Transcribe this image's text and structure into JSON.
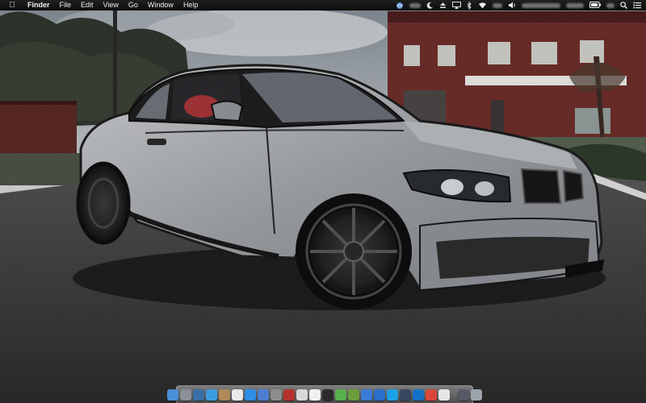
{
  "menubar": {
    "apple_icon": "apple-logo-icon",
    "app_name": "Finder",
    "items": [
      "File",
      "Edit",
      "View",
      "Go",
      "Window",
      "Help"
    ],
    "status_icons": [
      "globe-sync-icon",
      "crescent-icon",
      "eject-icon",
      "display-mirroring-icon",
      "bluetooth-icon",
      "wifi-icon",
      "volume-icon",
      "battery-icon",
      "spotlight-search-icon",
      "notification-center-icon"
    ]
  },
  "dock": {
    "apps": [
      {
        "name": "finder",
        "icon": "finder-icon",
        "color": "#4a90d9"
      },
      {
        "name": "launchpad",
        "icon": "launchpad-rocket-icon",
        "color": "#8a8f99"
      },
      {
        "name": "mission-control",
        "icon": "mission-control-icon",
        "color": "#3a6ea5"
      },
      {
        "name": "safari",
        "icon": "safari-compass-icon",
        "color": "#3b9de0"
      },
      {
        "name": "contacts",
        "icon": "contacts-book-icon",
        "color": "#b08a5a"
      },
      {
        "name": "calendar",
        "icon": "calendar-icon",
        "color": "#e9e9e9"
      },
      {
        "name": "app-store",
        "icon": "app-store-icon",
        "color": "#2d8ee6"
      },
      {
        "name": "itunes",
        "icon": "itunes-note-icon",
        "color": "#4b7fd1"
      },
      {
        "name": "system-preferences",
        "icon": "gear-icon",
        "color": "#8d8d8d"
      },
      {
        "name": "photo-booth",
        "icon": "photo-booth-icon",
        "color": "#b5342d"
      },
      {
        "name": "preview",
        "icon": "preview-photos-icon",
        "color": "#d9d9d9"
      },
      {
        "name": "textedit",
        "icon": "textedit-icon",
        "color": "#f0f0f0"
      },
      {
        "name": "terminal",
        "icon": "terminal-icon",
        "color": "#2b2b2b"
      },
      {
        "name": "maps",
        "icon": "maps-icon",
        "color": "#58b04c"
      },
      {
        "name": "minecraft",
        "icon": "minecraft-block-icon",
        "color": "#6b9d3a"
      },
      {
        "name": "xcode",
        "icon": "xcode-hammer-icon",
        "color": "#3a7bd5"
      },
      {
        "name": "quicktime",
        "icon": "quicktime-icon",
        "color": "#2a6fc9"
      },
      {
        "name": "skype",
        "icon": "skype-icon",
        "color": "#1ea1e6"
      },
      {
        "name": "steam",
        "icon": "steam-icon",
        "color": "#36475e"
      },
      {
        "name": "teamviewer",
        "icon": "teamviewer-icon",
        "color": "#1471c8"
      },
      {
        "name": "chrome",
        "icon": "chrome-icon",
        "color": "#d9473a"
      },
      {
        "name": "google-drive",
        "icon": "google-drive-icon",
        "color": "#e6e6e6"
      }
    ],
    "right_items": [
      {
        "name": "downloads-stack",
        "icon": "downloads-stack-icon",
        "color": "#555a66"
      },
      {
        "name": "trash",
        "icon": "trash-icon",
        "color": "#9ea4ab"
      }
    ]
  },
  "wallpaper": {
    "subject": "car-wallpaper-image",
    "colors": {
      "sky": "#9aa3ab",
      "road": "#3a3a3a",
      "car": "#a5a9ad",
      "building": "#6b2e2a",
      "trees": "#33382f"
    }
  }
}
